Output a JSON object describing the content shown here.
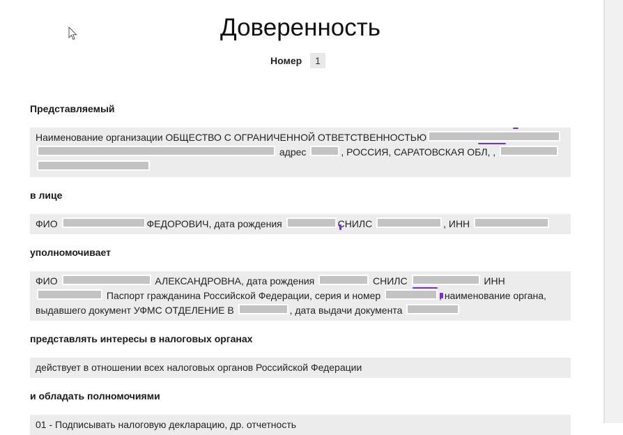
{
  "document": {
    "title": "Доверенность",
    "number_label": "Номер",
    "number_value": "1"
  },
  "sections": {
    "principal": {
      "heading": "Представляемый",
      "org_prefix": "Наименование организации ОБЩЕСТВО С ОГРАНИЧЕННОЙ ОТВЕТСТВЕННОСТЬЮ",
      "address_label": "адрес",
      "address_text": ", РОССИЯ, САРАТОВСКАЯ ОБЛ, ,"
    },
    "represented_by": {
      "heading": "в лице",
      "fio_label": "ФИО",
      "patronymic_dob": "ФЕДОРОВИЧ, дата рождения",
      "snils_label": "СНИЛС",
      "inn_label": ", ИНН"
    },
    "authorizes": {
      "heading": "уполномочивает",
      "fio_label": "ФИО",
      "patronymic_dob": "АЛЕКСАНДРОВНА, дата рождения",
      "snils_label": "СНИЛС",
      "inn_label": "ИНН",
      "passport_label": "Паспорт гражданина Российской Федерации, серия и номер",
      "issuer_label": ", наименование органа,",
      "issuer_text": "выдавшего документ УФМС ОТДЕЛЕНИЕ В",
      "issue_date_label": ", дата выдачи документа"
    },
    "tax_authorities": {
      "heading": "представлять интересы в налоговых органах",
      "text": "действует в отношении всех налоговых органов Российской Федерации"
    },
    "powers": {
      "heading": "и обладать полномочиями",
      "first_item": "01 - Подписывать налоговую декларацию, др. отчетность"
    }
  }
}
